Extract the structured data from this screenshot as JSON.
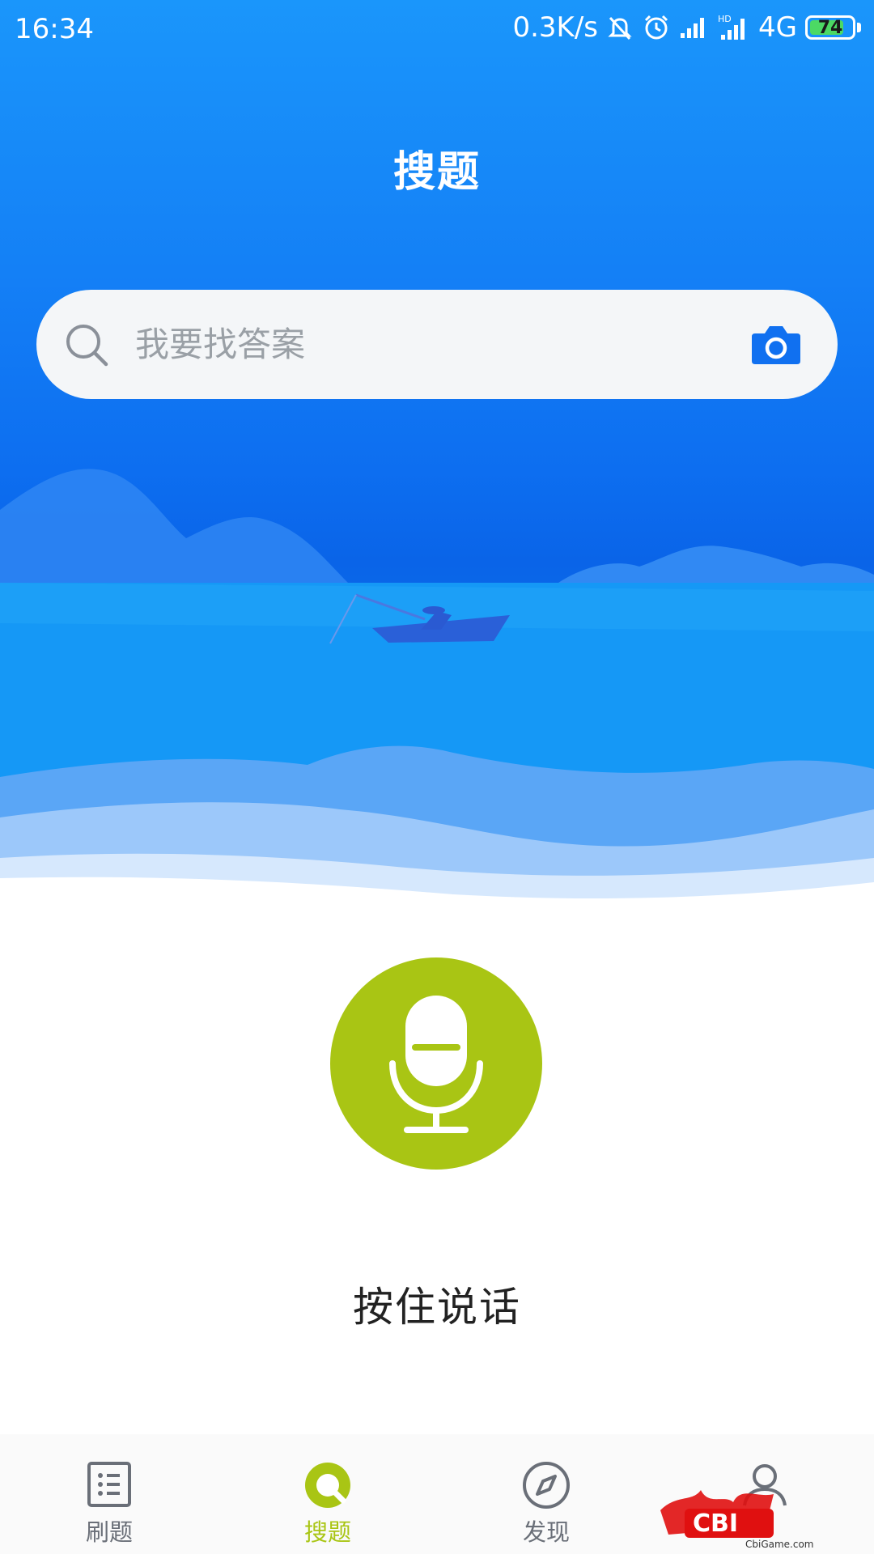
{
  "status_bar": {
    "time": "16:34",
    "network_speed": "0.3K/s",
    "network_type": "4G",
    "battery": "74",
    "icons": [
      "mute-bell-icon",
      "alarm-clock-icon",
      "signal-icon",
      "hd-signal-icon",
      "battery-icon"
    ]
  },
  "header": {
    "title": "搜题"
  },
  "search": {
    "placeholder": "我要找答案",
    "value": "",
    "left_icon": "search-icon",
    "right_icon": "camera-icon"
  },
  "voice": {
    "icon": "microphone-icon",
    "label": "按住说话"
  },
  "bottom_nav": {
    "items": [
      {
        "label": "刷题",
        "icon": "list-document-icon",
        "active": false
      },
      {
        "label": "搜题",
        "icon": "search-tab-icon",
        "active": true
      },
      {
        "label": "发现",
        "icon": "compass-icon",
        "active": false
      },
      {
        "label": "",
        "icon": "profile-icon",
        "active": false
      }
    ]
  },
  "watermark": {
    "brand": "CBI",
    "site": "CbiGame.com"
  },
  "colors": {
    "primary_blue": "#1480f6",
    "accent_green": "#a9c514",
    "nav_inactive": "#6a6f78",
    "camera_blue": "#1070f0"
  }
}
